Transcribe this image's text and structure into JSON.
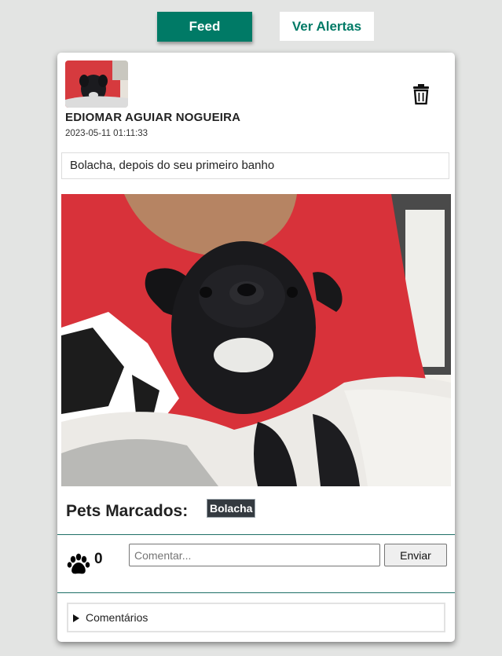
{
  "nav": {
    "feed_label": "Feed",
    "alerts_label": "Ver Alertas"
  },
  "post": {
    "author": "EDIOMAR AGUIAR NOGUEIRA",
    "timestamp": "2023-05-11 01:11:33",
    "caption": "Bolacha, depois do seu primeiro banho",
    "tagged_label": "Pets Marcados:",
    "tags": [
      "Bolacha"
    ],
    "likes": "0",
    "comment_placeholder": "Comentar...",
    "send_label": "Enviar",
    "comments_label": "Comentários"
  },
  "icons": {
    "delete": "trash-icon",
    "like": "paw-icon",
    "expand": "triangle-right-icon"
  },
  "colors": {
    "primary": "#007a66",
    "page_background": "#e3e4e3",
    "badge": "#343a40",
    "divider": "#1e6f66"
  }
}
